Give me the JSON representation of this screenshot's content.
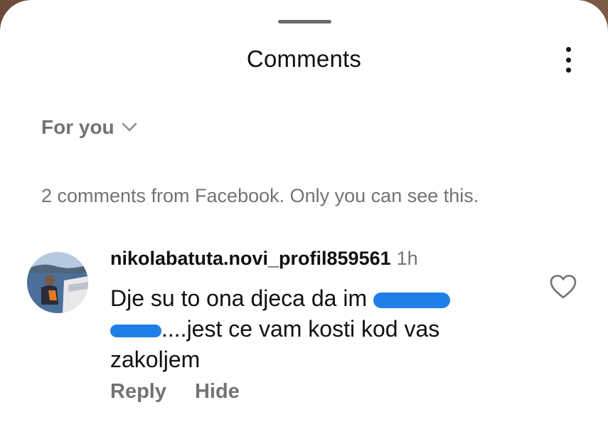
{
  "header": {
    "title": "Comments",
    "more_icon": "more-vertical-icon"
  },
  "sort": {
    "label": "For you",
    "icon": "chevron-down-icon"
  },
  "notice": "2 comments from Facebook. Only you can see this.",
  "comment": {
    "username": "nikolabatuta.novi_profil859561",
    "time": "1h",
    "text_part1": "Dje su to ona djeca da im ",
    "text_part2": "....jest ce vam kosti kod vas zakoljem",
    "redaction_color": "#1f7fe8",
    "like_icon": "heart-outline-icon",
    "actions": {
      "reply": "Reply",
      "hide": "Hide"
    }
  }
}
